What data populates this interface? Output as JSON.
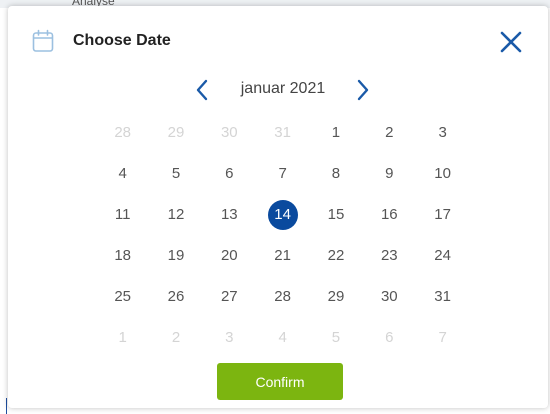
{
  "backdrop": {
    "text": "Analyse"
  },
  "dialog": {
    "title": "Choose Date",
    "month_label": "januar 2021",
    "confirm_label": "Confirm",
    "icons": {
      "calendar": "calendar-icon",
      "close": "close-icon",
      "prev": "chevron-left-icon",
      "next": "chevron-right-icon"
    },
    "accent_color": "#0a4a9e",
    "confirm_color": "#7cb510",
    "selected_day": "14",
    "days": [
      {
        "label": "28",
        "other": true
      },
      {
        "label": "29",
        "other": true
      },
      {
        "label": "30",
        "other": true
      },
      {
        "label": "31",
        "other": true
      },
      {
        "label": "1",
        "other": false
      },
      {
        "label": "2",
        "other": false
      },
      {
        "label": "3",
        "other": false
      },
      {
        "label": "4",
        "other": false
      },
      {
        "label": "5",
        "other": false
      },
      {
        "label": "6",
        "other": false
      },
      {
        "label": "7",
        "other": false
      },
      {
        "label": "8",
        "other": false
      },
      {
        "label": "9",
        "other": false
      },
      {
        "label": "10",
        "other": false
      },
      {
        "label": "11",
        "other": false
      },
      {
        "label": "12",
        "other": false
      },
      {
        "label": "13",
        "other": false
      },
      {
        "label": "14",
        "other": false
      },
      {
        "label": "15",
        "other": false
      },
      {
        "label": "16",
        "other": false
      },
      {
        "label": "17",
        "other": false
      },
      {
        "label": "18",
        "other": false
      },
      {
        "label": "19",
        "other": false
      },
      {
        "label": "20",
        "other": false
      },
      {
        "label": "21",
        "other": false
      },
      {
        "label": "22",
        "other": false
      },
      {
        "label": "23",
        "other": false
      },
      {
        "label": "24",
        "other": false
      },
      {
        "label": "25",
        "other": false
      },
      {
        "label": "26",
        "other": false
      },
      {
        "label": "27",
        "other": false
      },
      {
        "label": "28",
        "other": false
      },
      {
        "label": "29",
        "other": false
      },
      {
        "label": "30",
        "other": false
      },
      {
        "label": "31",
        "other": false
      },
      {
        "label": "1",
        "other": true
      },
      {
        "label": "2",
        "other": true
      },
      {
        "label": "3",
        "other": true
      },
      {
        "label": "4",
        "other": true
      },
      {
        "label": "5",
        "other": true
      },
      {
        "label": "6",
        "other": true
      },
      {
        "label": "7",
        "other": true
      }
    ]
  }
}
